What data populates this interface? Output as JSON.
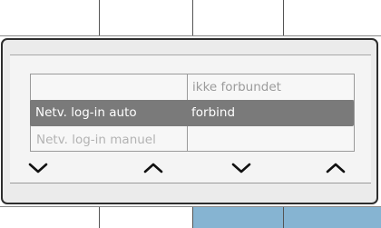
{
  "list": {
    "rows": [
      {
        "col1": "",
        "col2": "ikke forbundet",
        "selected": false
      },
      {
        "col1": "Netv. log-in auto",
        "col2": "forbind",
        "selected": true
      },
      {
        "col1": "Netv. log-in manuel",
        "col2": "",
        "selected": false
      }
    ]
  },
  "softkeys": [
    "chevron-down-icon",
    "chevron-up-icon",
    "chevron-down-icon",
    "chevron-up-icon"
  ],
  "colors": {
    "selected_row": "#7a7a7a",
    "active_tab": "#86b4d2",
    "dialog_border": "#2d2d2d"
  }
}
